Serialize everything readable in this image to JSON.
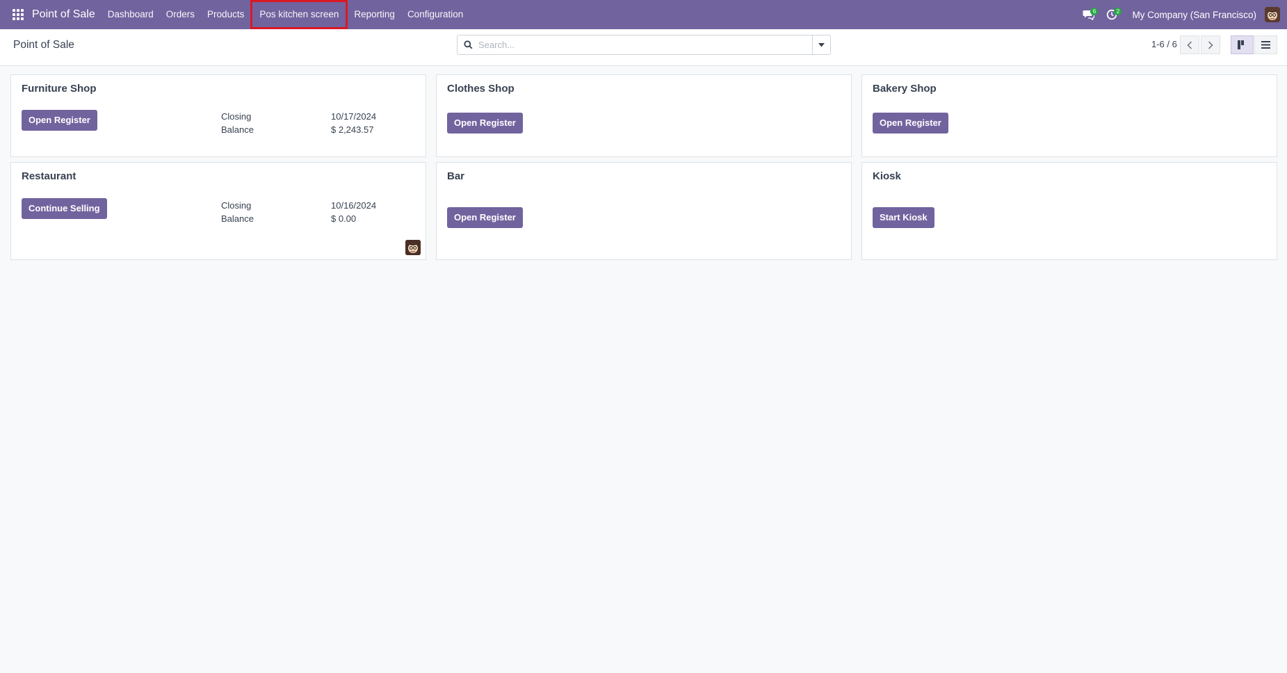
{
  "navbar": {
    "app_name": "Point of Sale",
    "menu": [
      {
        "label": "Dashboard"
      },
      {
        "label": "Orders"
      },
      {
        "label": "Products"
      },
      {
        "label": "Pos kitchen screen"
      },
      {
        "label": "Reporting"
      },
      {
        "label": "Configuration"
      }
    ],
    "messages_badge": "6",
    "activities_badge": "2",
    "company": "My Company (San Francisco)",
    "accent_color": "#71639e"
  },
  "control_panel": {
    "title": "Point of Sale",
    "search_placeholder": "Search...",
    "pager": "1-6 / 6"
  },
  "cards": [
    {
      "name": "Furniture Shop",
      "button": "Open Register",
      "closing_label": "Closing",
      "closing_value": "10/17/2024",
      "balance_label": "Balance",
      "balance_value": "$ 2,243.57"
    },
    {
      "name": "Clothes Shop",
      "button": "Open Register"
    },
    {
      "name": "Bakery Shop",
      "button": "Open Register"
    },
    {
      "name": "Restaurant",
      "button": "Continue Selling",
      "closing_label": "Closing",
      "closing_value": "10/16/2024",
      "balance_label": "Balance",
      "balance_value": "$ 0.00"
    },
    {
      "name": "Bar",
      "button": "Open Register"
    },
    {
      "name": "Kiosk",
      "button": "Start Kiosk"
    }
  ]
}
